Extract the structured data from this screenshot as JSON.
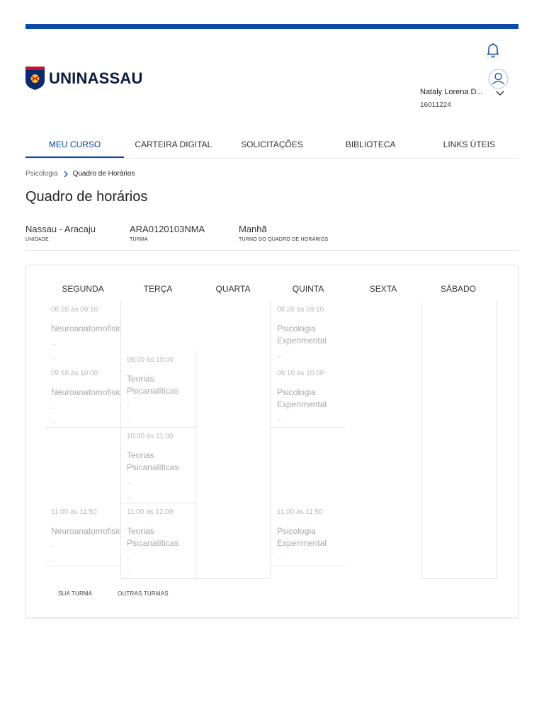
{
  "brand": {
    "name": "UNINASSAU",
    "accent": "#0a4aa8"
  },
  "user": {
    "name": "Nataly Lorena D...",
    "id": "16011224"
  },
  "icons": {
    "notifications": "bell-icon",
    "profile": "avatar-icon",
    "menu": "chevron-down-icon",
    "breadcrumb": "chevron-right-icon"
  },
  "nav": {
    "items": [
      {
        "label": "MEU CURSO",
        "active": true
      },
      {
        "label": "CARTEIRA DIGITAL"
      },
      {
        "label": "SOLICITAÇÕES"
      },
      {
        "label": "BIBLIOTECA"
      },
      {
        "label": "LINKS ÚTEIS"
      }
    ]
  },
  "breadcrumb": {
    "items": [
      "Psicologia",
      "Quadro de Horários"
    ]
  },
  "page": {
    "title": "Quadro de horários"
  },
  "info": [
    {
      "value": "Nassau - Aracaju",
      "label": "UNIDADE"
    },
    {
      "value": "ARA0120103NMA",
      "label": "TURMA"
    },
    {
      "value": "Manhã",
      "label": "TURNO DO QUADRO DE HORÁRIOS"
    }
  ],
  "schedule": {
    "days": [
      "SEGUNDA",
      "TERÇA",
      "QUARTA",
      "QUINTA",
      "SEXTA",
      "SÁBADO"
    ],
    "slots": {
      "mon_1": {
        "time": "08:20 às 09:10",
        "subject": "Neuroanatomofisiologia",
        "meta1": "--",
        "meta2": "--"
      },
      "mon_2": {
        "time": "09:10 às 10:00",
        "subject": "Neuroanatomofisiologia",
        "meta1": "--",
        "meta2": "--"
      },
      "mon_3": {
        "time": "11:00 às 11:50",
        "subject": "Neuroanatomofisiologia",
        "meta1": "--",
        "meta2": "--"
      },
      "tue_1": {
        "time": "09:00 às 10:00",
        "subject1": "Teorias",
        "subject2": "Psicanalíticas",
        "meta1": "--",
        "meta2": "--"
      },
      "tue_2": {
        "time": "10:00 às 11:00",
        "subject1": "Teorias",
        "subject2": "Psicanalíticas",
        "meta1": "--",
        "meta2": "--"
      },
      "tue_3": {
        "time": "11:00 às 12:00",
        "subject1": "Teorias",
        "subject2": "Psicanalíticas",
        "meta1": "--",
        "meta2": "--"
      },
      "thu_1": {
        "time": "08:20 às 09:10",
        "subject1": "Psicologia",
        "subject2": "Experimental",
        "meta1": "--"
      },
      "thu_2": {
        "time": "09:10 às 10:00",
        "subject1": "Psicologia",
        "subject2": "Experimental",
        "meta1": "--"
      },
      "thu_3": {
        "time": "11:00 às 11:50",
        "subject1": "Psicologia",
        "subject2": "Experimental",
        "meta1": "--"
      }
    }
  },
  "legend": {
    "own": "SUA TURMA",
    "others": "OUTRAS TURMAS"
  }
}
